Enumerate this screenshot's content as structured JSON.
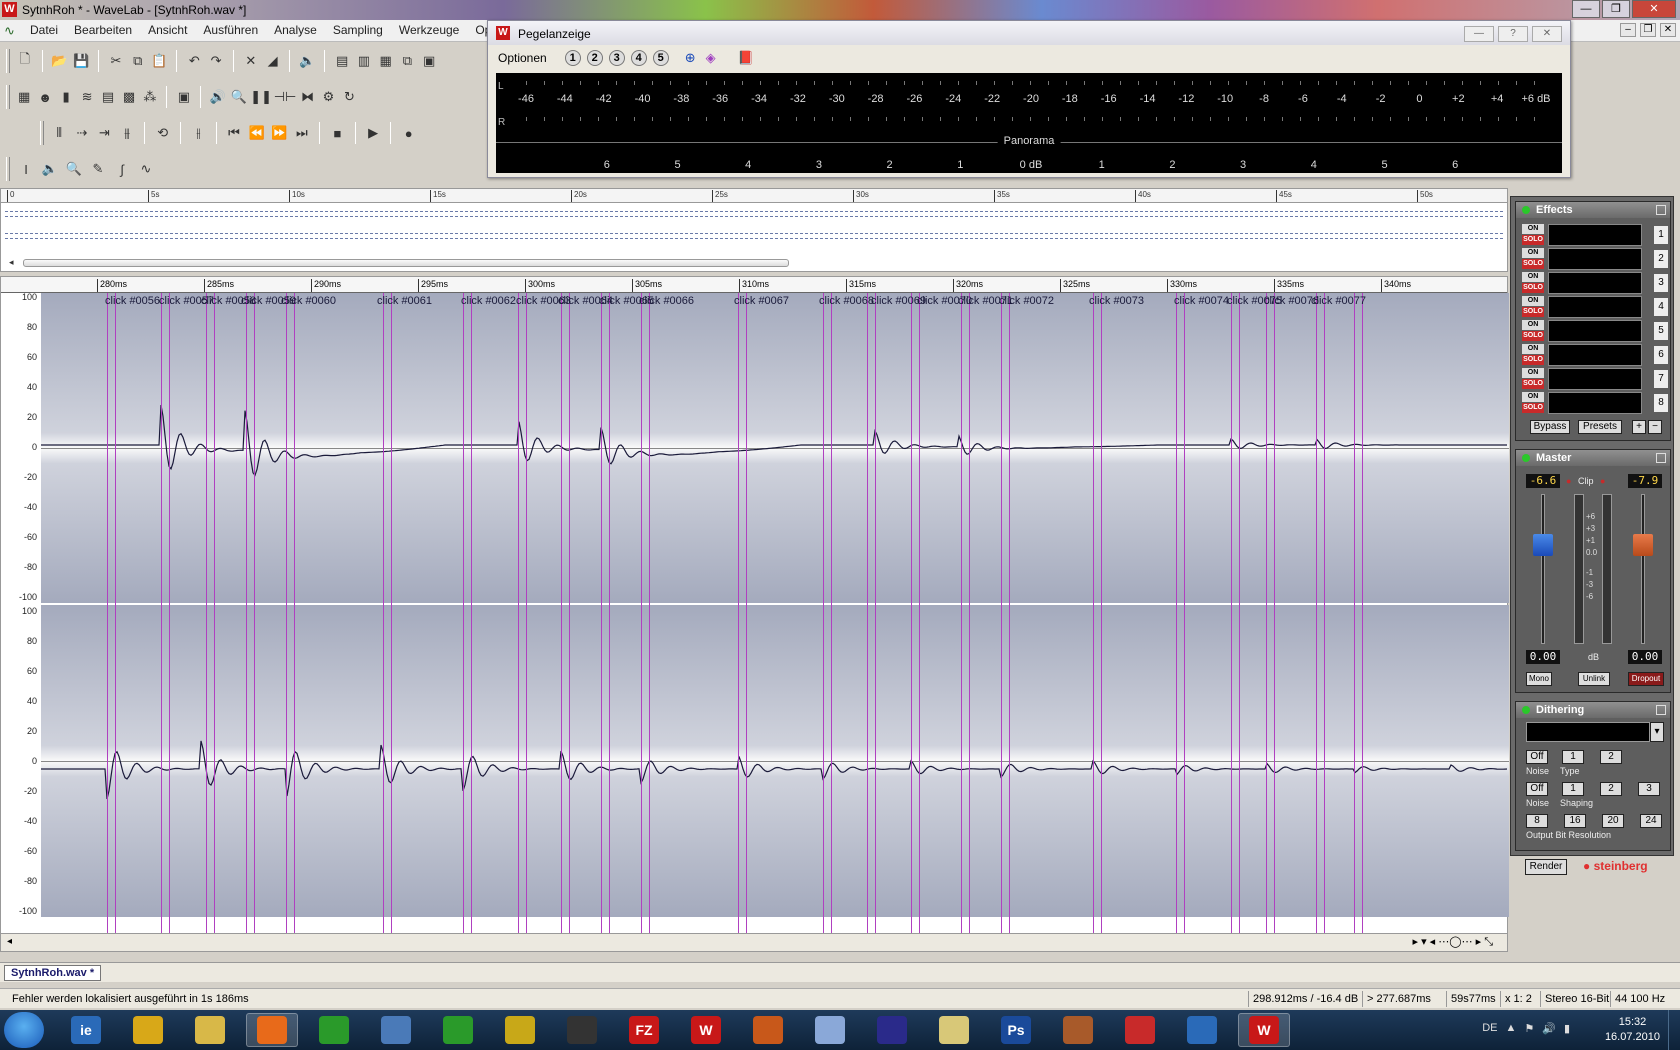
{
  "window": {
    "title": "SytnhRoh * - WaveLab - [SytnhRoh.wav *]",
    "min": "—",
    "max": "❐",
    "close": "✕"
  },
  "menu": {
    "items": [
      "Datei",
      "Bearbeiten",
      "Ansicht",
      "Ausführen",
      "Analyse",
      "Sampling",
      "Werkzeuge",
      "Optio"
    ]
  },
  "meter": {
    "title": "Pegelanzeige",
    "options_label": "Optionen",
    "presets": [
      "1",
      "2",
      "3",
      "4",
      "5"
    ],
    "btn_help": "?",
    "btn_close": "✕",
    "left_label": "L",
    "right_label": "R",
    "db_scale": [
      "-46",
      "-44",
      "-42",
      "-40",
      "-38",
      "-36",
      "-34",
      "-32",
      "-30",
      "-28",
      "-26",
      "-24",
      "-22",
      "-20",
      "-18",
      "-16",
      "-14",
      "-12",
      "-10",
      "-8",
      "-6",
      "-4",
      "-2",
      "0",
      "+2",
      "+4",
      "+6 dB"
    ],
    "panorama_label": "Panorama",
    "pan_scale": [
      "6",
      "5",
      "4",
      "3",
      "2",
      "1",
      "0 dB",
      "1",
      "2",
      "3",
      "4",
      "5",
      "6"
    ]
  },
  "overview_ruler": [
    "0",
    "5s",
    "10s",
    "15s",
    "20s",
    "25s",
    "30s",
    "35s",
    "40s",
    "45s",
    "50s"
  ],
  "wave_ruler": [
    "280ms",
    "285ms",
    "290ms",
    "295ms",
    "300ms",
    "305ms",
    "310ms",
    "315ms",
    "320ms",
    "325ms",
    "330ms",
    "335ms",
    "340ms"
  ],
  "scale_values": [
    "100",
    "80",
    "60",
    "40",
    "20",
    "0",
    "-20",
    "-40",
    "-60",
    "-80",
    "-100"
  ],
  "markers": [
    "click #0056",
    "click #0057",
    "click #0058",
    "click #0059",
    "click #0060",
    "click #0061",
    "click #0062",
    "click #0063",
    "click #0064",
    "click #0065",
    "click #0066",
    "click #0067",
    "click #0068",
    "click #0069",
    "click #0070",
    "click #0071",
    "click #0072",
    "click #0073",
    "click #0074",
    "click #0075",
    "click #0076",
    "click #0077"
  ],
  "panel": {
    "effects": {
      "title": "Effects",
      "on": "ON",
      "solo": "SOLO",
      "slots": [
        "1",
        "2",
        "3",
        "4",
        "5",
        "6",
        "7",
        "8"
      ],
      "bypass": "Bypass",
      "presets": "Presets",
      "add": "+",
      "remove": "−"
    },
    "master": {
      "title": "Master",
      "left_peak": "-6.6",
      "right_peak": "-7.9",
      "clip": "Clip",
      "scale": [
        "+6",
        "+3",
        "+1",
        "0.0",
        "-1",
        "-3",
        "-6"
      ],
      "left_value": "0.00",
      "right_value": "0.00",
      "db": "dB",
      "mono": "Mono",
      "unlink": "Unlink",
      "dropout": "Dropout"
    },
    "dithering": {
      "title": "Dithering",
      "noise_type_off": "Off",
      "noise_type_1": "1",
      "noise_type_2": "2",
      "noise_type_caption_a": "Noise",
      "noise_type_caption_b": "Type",
      "shaping_off": "Off",
      "shaping_1": "1",
      "shaping_2": "2",
      "shaping_3": "3",
      "shaping_caption_a": "Noise",
      "shaping_caption_b": "Shaping",
      "bits": [
        "8",
        "16",
        "20",
        "24"
      ],
      "bits_caption": "Output Bit Resolution",
      "render": "Render",
      "brand": "steinberg"
    }
  },
  "doc_tab": "SytnhRoh.wav *",
  "status": {
    "message": "Fehler werden lokalisiert ausgeführt in 1s 186ms",
    "position": "298.912ms / -16.4 dB",
    "selection": "> 277.687ms",
    "length": "59s77ms",
    "zoom": "x 1: 2",
    "format": "Stereo 16-Bit",
    "rate": "44 100 Hz"
  },
  "taskbar": {
    "apps": [
      "ie",
      "explorer",
      "folder",
      "firefox",
      "chrome",
      "people",
      "flower",
      "app",
      "live",
      "FZ",
      "W",
      "fire",
      "cube",
      "eclipse",
      "notepad",
      "Ps",
      "archive",
      "joystick",
      "globe",
      "W"
    ],
    "clock_time": "15:32",
    "clock_date": "16.07.2010",
    "tray_lang": "DE"
  }
}
